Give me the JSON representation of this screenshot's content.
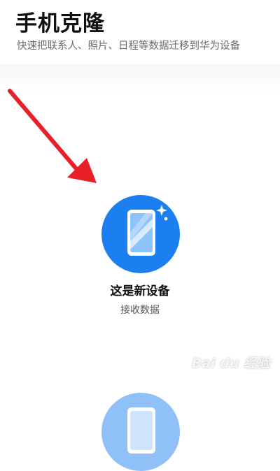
{
  "header": {
    "title": "手机克隆",
    "subtitle": "快速把联系人、照片、日程等数据迁移到华为设备"
  },
  "options": {
    "new_device": {
      "title": "这是新设备",
      "description": "接收数据",
      "icon": "new-phone-icon"
    },
    "old_device": {
      "icon": "old-phone-icon"
    }
  },
  "annotation": {
    "arrow": "red-arrow-pointing-to-new-device"
  },
  "watermark": {
    "text": "Bai du 经验"
  },
  "colors": {
    "accent": "#1b7ff0",
    "accent_light": "#8fc0f8",
    "arrow": "#e8202a"
  }
}
